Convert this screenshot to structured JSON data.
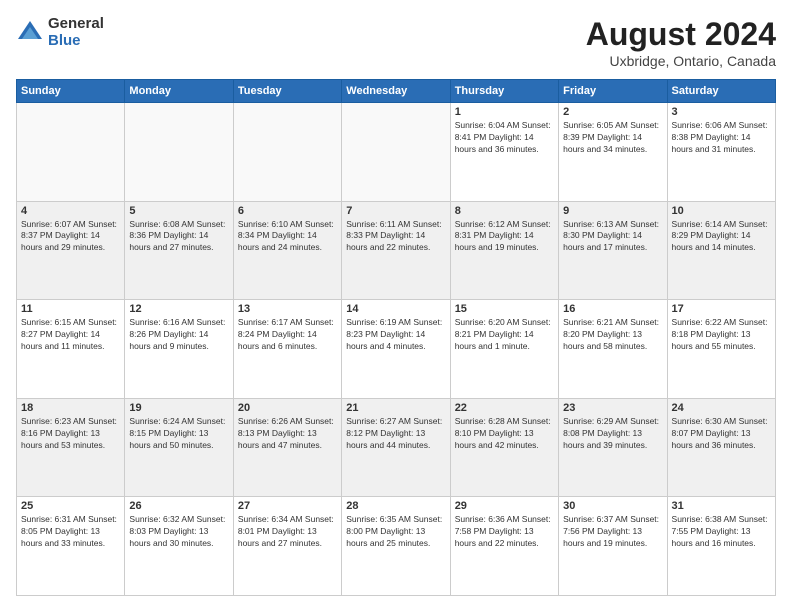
{
  "header": {
    "logo_general": "General",
    "logo_blue": "Blue",
    "title": "August 2024",
    "location": "Uxbridge, Ontario, Canada"
  },
  "calendar": {
    "days_of_week": [
      "Sunday",
      "Monday",
      "Tuesday",
      "Wednesday",
      "Thursday",
      "Friday",
      "Saturday"
    ],
    "weeks": [
      [
        {
          "day": "",
          "info": ""
        },
        {
          "day": "",
          "info": ""
        },
        {
          "day": "",
          "info": ""
        },
        {
          "day": "",
          "info": ""
        },
        {
          "day": "1",
          "info": "Sunrise: 6:04 AM\nSunset: 8:41 PM\nDaylight: 14 hours and 36 minutes."
        },
        {
          "day": "2",
          "info": "Sunrise: 6:05 AM\nSunset: 8:39 PM\nDaylight: 14 hours and 34 minutes."
        },
        {
          "day": "3",
          "info": "Sunrise: 6:06 AM\nSunset: 8:38 PM\nDaylight: 14 hours and 31 minutes."
        }
      ],
      [
        {
          "day": "4",
          "info": "Sunrise: 6:07 AM\nSunset: 8:37 PM\nDaylight: 14 hours and 29 minutes."
        },
        {
          "day": "5",
          "info": "Sunrise: 6:08 AM\nSunset: 8:36 PM\nDaylight: 14 hours and 27 minutes."
        },
        {
          "day": "6",
          "info": "Sunrise: 6:10 AM\nSunset: 8:34 PM\nDaylight: 14 hours and 24 minutes."
        },
        {
          "day": "7",
          "info": "Sunrise: 6:11 AM\nSunset: 8:33 PM\nDaylight: 14 hours and 22 minutes."
        },
        {
          "day": "8",
          "info": "Sunrise: 6:12 AM\nSunset: 8:31 PM\nDaylight: 14 hours and 19 minutes."
        },
        {
          "day": "9",
          "info": "Sunrise: 6:13 AM\nSunset: 8:30 PM\nDaylight: 14 hours and 17 minutes."
        },
        {
          "day": "10",
          "info": "Sunrise: 6:14 AM\nSunset: 8:29 PM\nDaylight: 14 hours and 14 minutes."
        }
      ],
      [
        {
          "day": "11",
          "info": "Sunrise: 6:15 AM\nSunset: 8:27 PM\nDaylight: 14 hours and 11 minutes."
        },
        {
          "day": "12",
          "info": "Sunrise: 6:16 AM\nSunset: 8:26 PM\nDaylight: 14 hours and 9 minutes."
        },
        {
          "day": "13",
          "info": "Sunrise: 6:17 AM\nSunset: 8:24 PM\nDaylight: 14 hours and 6 minutes."
        },
        {
          "day": "14",
          "info": "Sunrise: 6:19 AM\nSunset: 8:23 PM\nDaylight: 14 hours and 4 minutes."
        },
        {
          "day": "15",
          "info": "Sunrise: 6:20 AM\nSunset: 8:21 PM\nDaylight: 14 hours and 1 minute."
        },
        {
          "day": "16",
          "info": "Sunrise: 6:21 AM\nSunset: 8:20 PM\nDaylight: 13 hours and 58 minutes."
        },
        {
          "day": "17",
          "info": "Sunrise: 6:22 AM\nSunset: 8:18 PM\nDaylight: 13 hours and 55 minutes."
        }
      ],
      [
        {
          "day": "18",
          "info": "Sunrise: 6:23 AM\nSunset: 8:16 PM\nDaylight: 13 hours and 53 minutes."
        },
        {
          "day": "19",
          "info": "Sunrise: 6:24 AM\nSunset: 8:15 PM\nDaylight: 13 hours and 50 minutes."
        },
        {
          "day": "20",
          "info": "Sunrise: 6:26 AM\nSunset: 8:13 PM\nDaylight: 13 hours and 47 minutes."
        },
        {
          "day": "21",
          "info": "Sunrise: 6:27 AM\nSunset: 8:12 PM\nDaylight: 13 hours and 44 minutes."
        },
        {
          "day": "22",
          "info": "Sunrise: 6:28 AM\nSunset: 8:10 PM\nDaylight: 13 hours and 42 minutes."
        },
        {
          "day": "23",
          "info": "Sunrise: 6:29 AM\nSunset: 8:08 PM\nDaylight: 13 hours and 39 minutes."
        },
        {
          "day": "24",
          "info": "Sunrise: 6:30 AM\nSunset: 8:07 PM\nDaylight: 13 hours and 36 minutes."
        }
      ],
      [
        {
          "day": "25",
          "info": "Sunrise: 6:31 AM\nSunset: 8:05 PM\nDaylight: 13 hours and 33 minutes."
        },
        {
          "day": "26",
          "info": "Sunrise: 6:32 AM\nSunset: 8:03 PM\nDaylight: 13 hours and 30 minutes."
        },
        {
          "day": "27",
          "info": "Sunrise: 6:34 AM\nSunset: 8:01 PM\nDaylight: 13 hours and 27 minutes."
        },
        {
          "day": "28",
          "info": "Sunrise: 6:35 AM\nSunset: 8:00 PM\nDaylight: 13 hours and 25 minutes."
        },
        {
          "day": "29",
          "info": "Sunrise: 6:36 AM\nSunset: 7:58 PM\nDaylight: 13 hours and 22 minutes."
        },
        {
          "day": "30",
          "info": "Sunrise: 6:37 AM\nSunset: 7:56 PM\nDaylight: 13 hours and 19 minutes."
        },
        {
          "day": "31",
          "info": "Sunrise: 6:38 AM\nSunset: 7:55 PM\nDaylight: 13 hours and 16 minutes."
        }
      ]
    ]
  }
}
